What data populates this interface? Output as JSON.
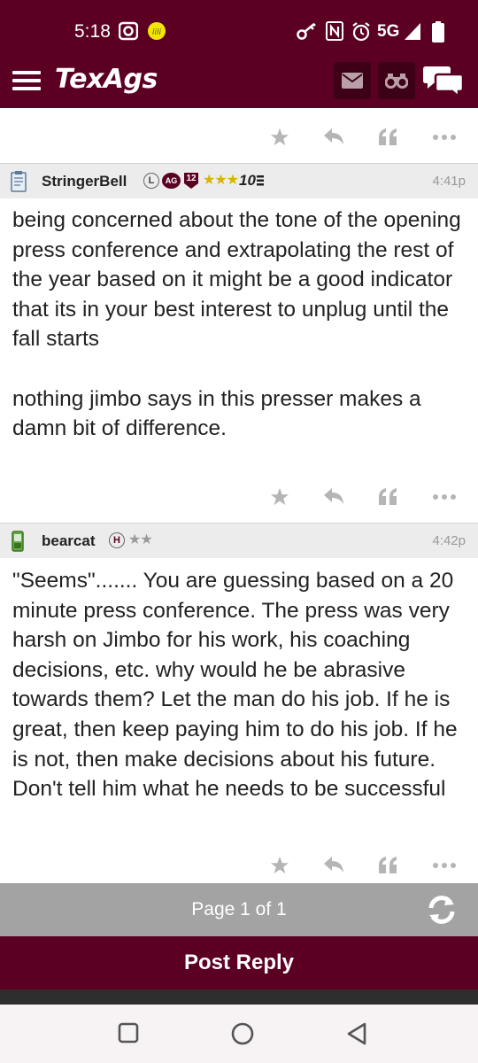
{
  "status_bar": {
    "time": "5:18",
    "network": "5G"
  },
  "header": {
    "logo": "TexAgs",
    "icons": [
      "menu-icon",
      "mail-icon",
      "binoculars-icon",
      "chat-icon"
    ]
  },
  "posts": [
    {
      "username": "StringerBell",
      "badges": {
        "l": "L",
        "ag": "AG",
        "year": "12",
        "stars": "★★★",
        "rank": "10"
      },
      "time": "4:41p",
      "paragraphs": [
        "being concerned about the tone of the opening press conference and extrapolating the rest of the year based on it might be a good indicator that its in your best interest to unplug until the fall starts",
        "nothing jimbo says in this presser makes a damn bit of difference."
      ]
    },
    {
      "username": "bearcat",
      "badges": {
        "h": "H",
        "stars": "★★"
      },
      "time": "4:42p",
      "paragraphs": [
        "\"Seems\"....... You are guessing based on a 20 minute press conference. The press was very harsh on Jimbo for his work, his coaching decisions, etc. why would he be abrasive towards them? Let the man do his job. If he is great, then keep paying him to do his job. If he is not, then make decisions about his future. Don't tell him what he needs to be successful"
      ]
    }
  ],
  "pagination": {
    "label": "Page 1 of 1"
  },
  "reply_button": {
    "label": "Post Reply"
  },
  "colors": {
    "maroon": "#5b0022",
    "gray_bar": "#a3a3a3",
    "star_gold": "#d9b300"
  }
}
